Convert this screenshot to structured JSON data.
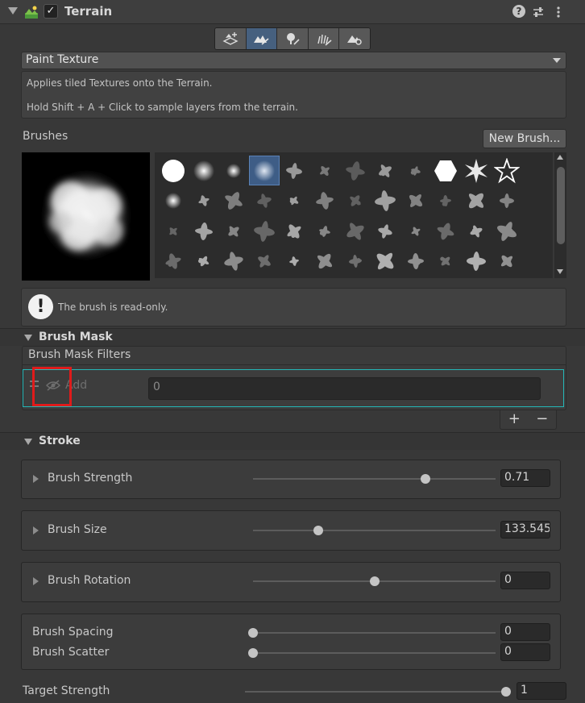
{
  "header": {
    "title": "Terrain",
    "help_glyph": "?",
    "check_glyph": "✓"
  },
  "mode_dropdown": {
    "value": "Paint Texture"
  },
  "description": {
    "line1": "Applies tiled Textures onto the Terrain.",
    "line2": "Hold Shift + A + Click to sample layers from the terrain."
  },
  "brushes": {
    "label": "Brushes",
    "new_brush_label": "New Brush...",
    "selected_index": 3,
    "count": 48
  },
  "readonly_message": "The brush is read-only.",
  "brush_mask": {
    "section_title": "Brush Mask",
    "filters_title": "Brush Mask Filters",
    "add_label": "Add",
    "value": "0",
    "plus": "+",
    "minus": "−"
  },
  "stroke": {
    "section_title": "Stroke",
    "brush_strength": {
      "label": "Brush Strength",
      "value": "0.71",
      "fraction": 0.71
    },
    "brush_size": {
      "label": "Brush Size",
      "value": "133.545",
      "fraction": 0.27
    },
    "brush_rotation": {
      "label": "Brush Rotation",
      "value": "0",
      "fraction": 0.5
    },
    "brush_spacing": {
      "label": "Brush Spacing",
      "value": "0",
      "fraction": 0.0
    },
    "brush_scatter": {
      "label": "Brush Scatter",
      "value": "0",
      "fraction": 0.0
    }
  },
  "target_strength": {
    "label": "Target Strength",
    "value": "1",
    "fraction": 1.0
  }
}
